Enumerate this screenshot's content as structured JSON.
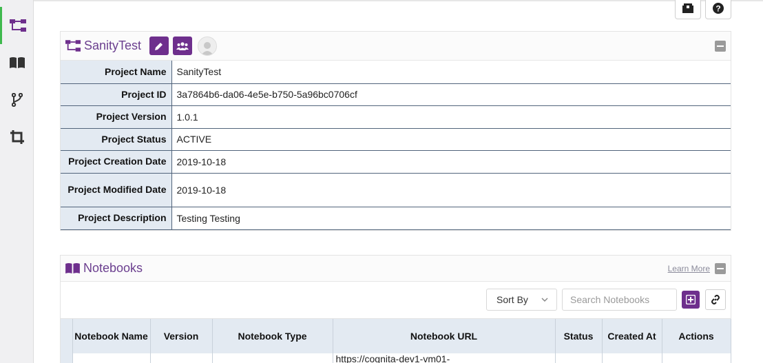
{
  "sidebar": {
    "items": [
      {
        "icon": "project-hierarchy-icon",
        "active": true
      },
      {
        "icon": "book-icon",
        "active": false
      },
      {
        "icon": "branch-icon",
        "active": false
      },
      {
        "icon": "crop-icon",
        "active": false
      }
    ]
  },
  "top_buttons": [
    {
      "icon": "package-icon"
    },
    {
      "icon": "help-icon"
    }
  ],
  "project": {
    "title": "SanityTest",
    "rows": [
      {
        "label": "Project Name",
        "value": "SanityTest"
      },
      {
        "label": "Project ID",
        "value": "3a7864b6-da06-4e5e-b750-5a96bc0706cf"
      },
      {
        "label": "Project Version",
        "value": "1.0.1"
      },
      {
        "label": "Project Status",
        "value": "ACTIVE"
      },
      {
        "label": "Project Creation Date",
        "value": "2019-10-18"
      },
      {
        "label": "Project Modified Date",
        "value": "2019-10-18"
      },
      {
        "label": "Project Description",
        "value": "Testing Testing"
      }
    ]
  },
  "notebooks": {
    "title": "Notebooks",
    "learn_more": "Learn More",
    "sort_by": "Sort By",
    "search_placeholder": "Search Notebooks",
    "columns": [
      "",
      "Notebook Name",
      "Version",
      "Notebook Type",
      "Notebook URL",
      "Status",
      "Created At",
      "Actions"
    ],
    "rows": [
      {
        "name": "",
        "version": "",
        "type": "",
        "url": "https://cognita-dev1-vm01-",
        "status": "",
        "created": "",
        "actions": ""
      }
    ]
  },
  "colors": {
    "accent": "#6e2f8d",
    "active_status": "#3c9e57",
    "header_bg": "#e3eaf2"
  }
}
